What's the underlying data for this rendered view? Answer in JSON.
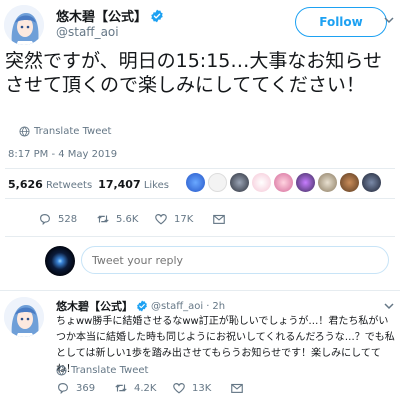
{
  "main_tweet": {
    "display_name": "悠木碧【公式】",
    "handle": "@staff_aoi",
    "follow_label": "Follow",
    "text": "突然ですが、明日の15:15…大事なお知らせさせて頂くので楽しみにしててください！",
    "translate_label": "Translate Tweet",
    "timestamp": "8:17 PM - 4 May 2019",
    "retweets_count": "5,626",
    "retweets_label": "Retweets",
    "likes_count": "17,407",
    "likes_label": "Likes",
    "actions": {
      "reply_count": "528",
      "retweet_count": "5.6K",
      "like_count": "17K"
    }
  },
  "composer": {
    "placeholder": "Tweet your reply"
  },
  "reply_tweet": {
    "display_name": "悠木碧【公式】",
    "handle": "@staff_aoi",
    "separator": "·",
    "age": "2h",
    "text": "ちょww勝手に結婚させるなww訂正が恥しいでしょうが…！君たち私がいつか本当に結婚した時も同じようにお祝いしてくれるんだろうな…？でも私としては新しい1歩を踏み出させてもらうお知らせです！楽しみにしててね！",
    "translate_label": "Translate Tweet",
    "actions": {
      "reply_count": "369",
      "retweet_count": "4.2K",
      "like_count": "13K"
    }
  },
  "colors": {
    "accent": "#1da1f2",
    "text": "#14171a",
    "muted": "#657786",
    "divider": "#e6ecf0"
  }
}
